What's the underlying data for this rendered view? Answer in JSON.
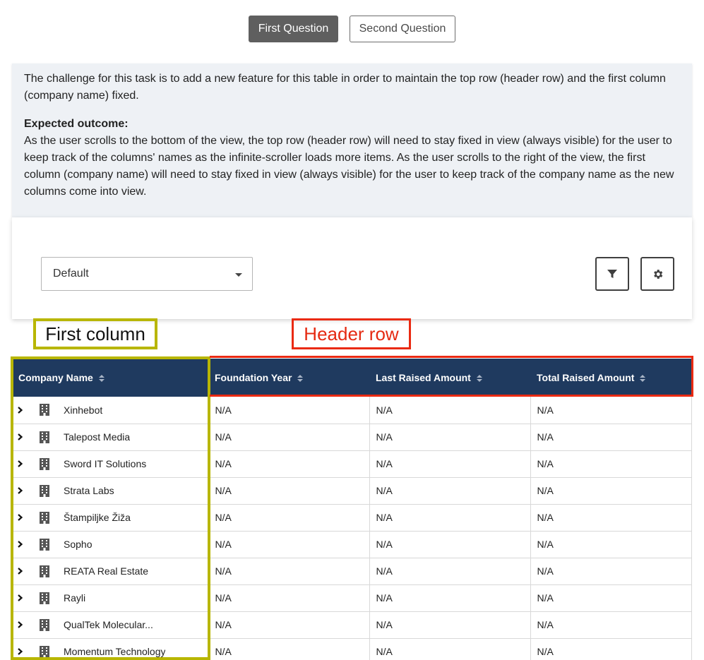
{
  "tabs": [
    {
      "label": "First Question",
      "active": true
    },
    {
      "label": "Second Question",
      "active": false
    }
  ],
  "info": {
    "challenge": "The challenge for this task is to add a new feature for this table in order to maintain the top row (header row) and the first column (company name) fixed.",
    "outcome_title": "Expected outcome:",
    "outcome_text": "As the user scrolls to the bottom of the view, the top row (header row) will need to stay fixed in view (always visible) for the user to keep track of the columns' names as the infinite-scroller loads more items. As the user scrolls to the right of the view, the first column (company name) will need to stay fixed in view (always visible) for the user to keep track of the company name as the new columns come into view."
  },
  "toolbar": {
    "select_value": "Default",
    "filter_icon": "filter-icon",
    "gear_icon": "gear-icon"
  },
  "annotations": {
    "first_column": "First column",
    "header_row": "Header row"
  },
  "table": {
    "columns": [
      "Company Name",
      "Foundation Year",
      "Last Raised Amount",
      "Total Raised Amount"
    ],
    "rows": [
      {
        "name": "Xinhebot",
        "foundation_year": "N/A",
        "last_raised": "N/A",
        "total_raised": "N/A"
      },
      {
        "name": "Talepost Media",
        "foundation_year": "N/A",
        "last_raised": "N/A",
        "total_raised": "N/A"
      },
      {
        "name": "Sword IT Solutions",
        "foundation_year": "N/A",
        "last_raised": "N/A",
        "total_raised": "N/A"
      },
      {
        "name": "Strata Labs",
        "foundation_year": "N/A",
        "last_raised": "N/A",
        "total_raised": "N/A"
      },
      {
        "name": "Štampiljke Žiža",
        "foundation_year": "N/A",
        "last_raised": "N/A",
        "total_raised": "N/A"
      },
      {
        "name": "Sopho",
        "foundation_year": "N/A",
        "last_raised": "N/A",
        "total_raised": "N/A"
      },
      {
        "name": "REATA Real Estate",
        "foundation_year": "N/A",
        "last_raised": "N/A",
        "total_raised": "N/A"
      },
      {
        "name": "Rayli",
        "foundation_year": "N/A",
        "last_raised": "N/A",
        "total_raised": "N/A"
      },
      {
        "name": "QualTek Molecular...",
        "foundation_year": "N/A",
        "last_raised": "N/A",
        "total_raised": "N/A"
      },
      {
        "name": "Momentum Technology",
        "foundation_year": "N/A",
        "last_raised": "N/A",
        "total_raised": "N/A"
      }
    ]
  },
  "colors": {
    "header_bg": "#1f3a5f",
    "first_column_frame": "#b8b600",
    "header_row_frame": "#ea2a12"
  }
}
